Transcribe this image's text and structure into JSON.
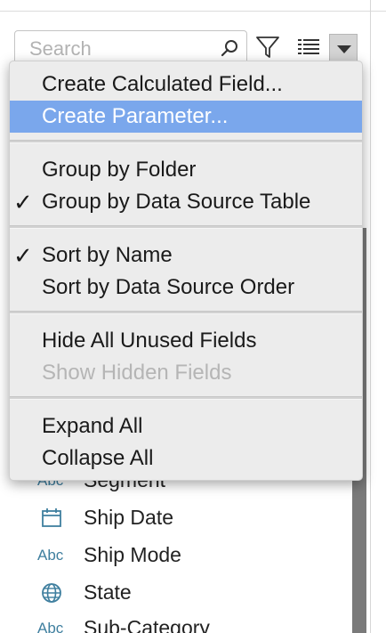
{
  "search": {
    "placeholder": "Search"
  },
  "menu": {
    "items": [
      {
        "label": "Create Calculated Field...",
        "checked": false,
        "highlighted": false,
        "disabled": false
      },
      {
        "label": "Create Parameter...",
        "checked": false,
        "highlighted": true,
        "disabled": false
      },
      {
        "label": "Group by Folder",
        "checked": false,
        "highlighted": false,
        "disabled": false
      },
      {
        "label": "Group by Data Source Table",
        "checked": true,
        "highlighted": false,
        "disabled": false
      },
      {
        "label": "Sort by Name",
        "checked": true,
        "highlighted": false,
        "disabled": false
      },
      {
        "label": "Sort by Data Source Order",
        "checked": false,
        "highlighted": false,
        "disabled": false
      },
      {
        "label": "Hide All Unused Fields",
        "checked": false,
        "highlighted": false,
        "disabled": false
      },
      {
        "label": "Show Hidden Fields",
        "checked": false,
        "highlighted": false,
        "disabled": true
      },
      {
        "label": "Expand All",
        "checked": false,
        "highlighted": false,
        "disabled": false
      },
      {
        "label": "Collapse All",
        "checked": false,
        "highlighted": false,
        "disabled": false
      }
    ],
    "check_glyph": "✓"
  },
  "fields": [
    {
      "icon": "abc-icon",
      "icon_text": "Abc",
      "label": "Segment"
    },
    {
      "icon": "calendar-icon",
      "icon_text": "",
      "label": "Ship Date"
    },
    {
      "icon": "abc-icon",
      "icon_text": "Abc",
      "label": "Ship Mode"
    },
    {
      "icon": "globe-icon",
      "icon_text": "",
      "label": "State"
    },
    {
      "icon": "abc-icon",
      "icon_text": "Abc",
      "label": "Sub-Category"
    }
  ],
  "colors": {
    "highlight": "#7aa7ec",
    "field_icon": "#3f7f9f",
    "menu_bg": "#ececec"
  }
}
